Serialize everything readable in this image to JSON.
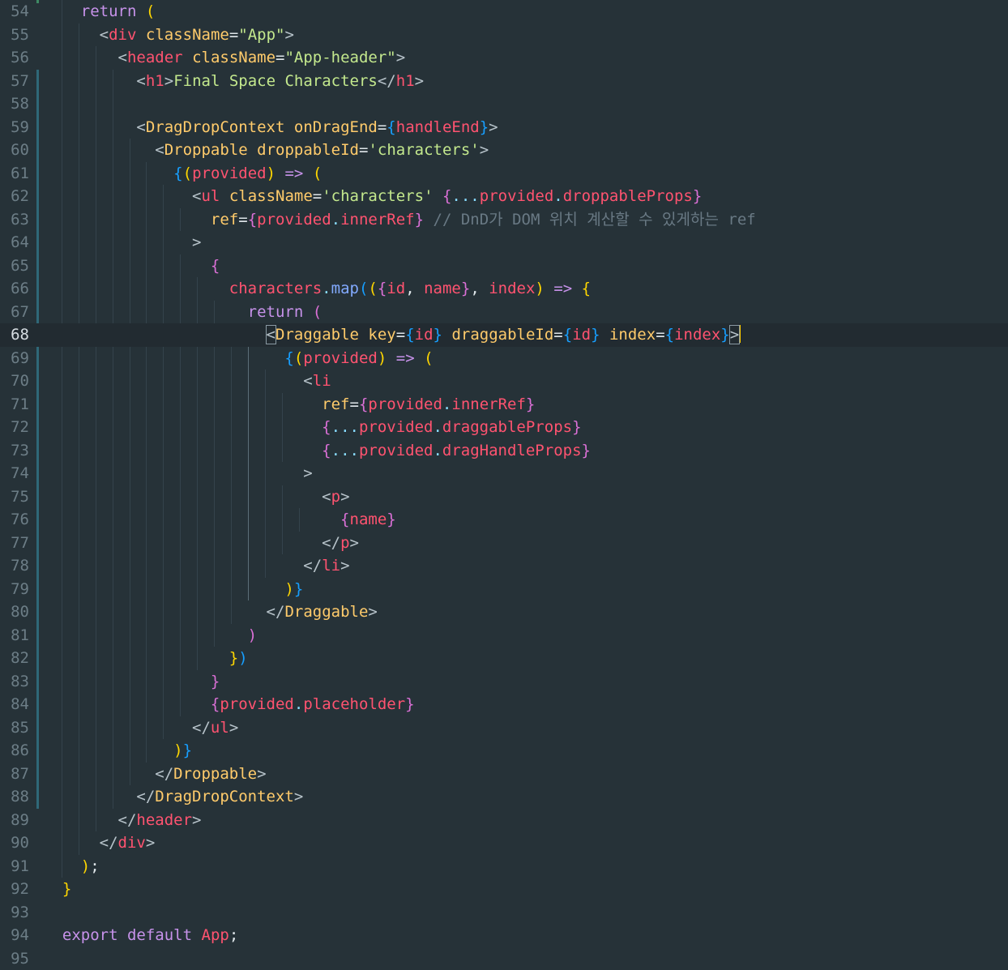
{
  "editor": {
    "active_line": 68,
    "lines": [
      {
        "n": "54",
        "t": [
          [
            "t-kw",
            "    return "
          ],
          [
            "t-br1",
            "("
          ]
        ]
      },
      {
        "n": "55",
        "t": [
          [
            "t-plain",
            "      "
          ],
          [
            "t-dim",
            "<"
          ],
          [
            "t-tag",
            "div"
          ],
          [
            "t-plain",
            " "
          ],
          [
            "t-attr",
            "className"
          ],
          [
            "t-plain",
            "="
          ],
          [
            "t-str",
            "\"App\""
          ],
          [
            "t-dim",
            ">"
          ]
        ]
      },
      {
        "n": "56",
        "t": [
          [
            "t-plain",
            "        "
          ],
          [
            "t-dim",
            "<"
          ],
          [
            "t-tag",
            "header"
          ],
          [
            "t-plain",
            " "
          ],
          [
            "t-attr",
            "className"
          ],
          [
            "t-plain",
            "="
          ],
          [
            "t-str",
            "\"App-header\""
          ],
          [
            "t-dim",
            ">"
          ]
        ]
      },
      {
        "n": "57",
        "t": [
          [
            "t-plain",
            "          "
          ],
          [
            "t-dim",
            "<"
          ],
          [
            "t-tag",
            "h1"
          ],
          [
            "t-dim",
            ">"
          ],
          [
            "t-str",
            "Final Space Characters"
          ],
          [
            "t-dim",
            "</"
          ],
          [
            "t-tag",
            "h1"
          ],
          [
            "t-dim",
            ">"
          ]
        ]
      },
      {
        "n": "58",
        "t": []
      },
      {
        "n": "59",
        "t": [
          [
            "t-plain",
            "          "
          ],
          [
            "t-dim",
            "<"
          ],
          [
            "t-attr",
            "DragDropContext"
          ],
          [
            "t-plain",
            " "
          ],
          [
            "t-attr",
            "onDragEnd"
          ],
          [
            "t-plain",
            "="
          ],
          [
            "t-br3",
            "{"
          ],
          [
            "t-var",
            "handleEnd"
          ],
          [
            "t-br3",
            "}"
          ],
          [
            "t-dim",
            ">"
          ]
        ]
      },
      {
        "n": "60",
        "t": [
          [
            "t-plain",
            "            "
          ],
          [
            "t-dim",
            "<"
          ],
          [
            "t-attr",
            "Droppable"
          ],
          [
            "t-plain",
            " "
          ],
          [
            "t-attr",
            "droppableId"
          ],
          [
            "t-plain",
            "="
          ],
          [
            "t-str",
            "'characters'"
          ],
          [
            "t-dim",
            ">"
          ]
        ]
      },
      {
        "n": "61",
        "t": [
          [
            "t-plain",
            "              "
          ],
          [
            "t-br3",
            "{"
          ],
          [
            "t-br1",
            "("
          ],
          [
            "t-var",
            "provided"
          ],
          [
            "t-br1",
            ")"
          ],
          [
            "t-plain",
            " "
          ],
          [
            "t-kw",
            "=>"
          ],
          [
            "t-plain",
            " "
          ],
          [
            "t-br1",
            "("
          ]
        ]
      },
      {
        "n": "62",
        "t": [
          [
            "t-plain",
            "                "
          ],
          [
            "t-dim",
            "<"
          ],
          [
            "t-tag",
            "ul"
          ],
          [
            "t-plain",
            " "
          ],
          [
            "t-attr",
            "className"
          ],
          [
            "t-plain",
            "="
          ],
          [
            "t-str",
            "'characters'"
          ],
          [
            "t-plain",
            " "
          ],
          [
            "t-br2",
            "{"
          ],
          [
            "t-punc",
            "..."
          ],
          [
            "t-var",
            "provided"
          ],
          [
            "t-punc",
            "."
          ],
          [
            "t-prop",
            "droppableProps"
          ],
          [
            "t-br2",
            "}"
          ]
        ]
      },
      {
        "n": "63",
        "t": [
          [
            "t-plain",
            "                  "
          ],
          [
            "t-attr",
            "ref"
          ],
          [
            "t-plain",
            "="
          ],
          [
            "t-br2",
            "{"
          ],
          [
            "t-var",
            "provided"
          ],
          [
            "t-punc",
            "."
          ],
          [
            "t-prop",
            "innerRef"
          ],
          [
            "t-br2",
            "}"
          ],
          [
            "t-plain",
            " "
          ],
          [
            "t-cmt",
            "// DnD가 DOM 위치 계산할 수 있게하는 ref"
          ]
        ]
      },
      {
        "n": "64",
        "t": [
          [
            "t-plain",
            "                "
          ],
          [
            "t-dim",
            ">"
          ]
        ]
      },
      {
        "n": "65",
        "t": [
          [
            "t-plain",
            "                  "
          ],
          [
            "t-br2",
            "{"
          ]
        ]
      },
      {
        "n": "66",
        "t": [
          [
            "t-plain",
            "                    "
          ],
          [
            "t-var",
            "characters"
          ],
          [
            "t-punc",
            "."
          ],
          [
            "t-fn",
            "map"
          ],
          [
            "t-br3",
            "("
          ],
          [
            "t-br1",
            "("
          ],
          [
            "t-br2",
            "{"
          ],
          [
            "t-var",
            "id"
          ],
          [
            "t-plain",
            ", "
          ],
          [
            "t-var",
            "name"
          ],
          [
            "t-br2",
            "}"
          ],
          [
            "t-plain",
            ", "
          ],
          [
            "t-var",
            "index"
          ],
          [
            "t-br1",
            ")"
          ],
          [
            "t-plain",
            " "
          ],
          [
            "t-kw",
            "=>"
          ],
          [
            "t-plain",
            " "
          ],
          [
            "t-br1",
            "{"
          ]
        ]
      },
      {
        "n": "67",
        "t": [
          [
            "t-plain",
            "                      "
          ],
          [
            "t-kw",
            "return"
          ],
          [
            "t-plain",
            " "
          ],
          [
            "t-br2",
            "("
          ]
        ]
      },
      {
        "n": "68",
        "t": [
          [
            "t-plain",
            "                        "
          ],
          [
            "t-dim hl",
            "<"
          ],
          [
            "t-attr",
            "Draggable"
          ],
          [
            "t-plain",
            " "
          ],
          [
            "t-attr",
            "key"
          ],
          [
            "t-plain",
            "="
          ],
          [
            "t-br3",
            "{"
          ],
          [
            "t-var",
            "id"
          ],
          [
            "t-br3",
            "}"
          ],
          [
            "t-plain",
            " "
          ],
          [
            "t-attr",
            "draggableId"
          ],
          [
            "t-plain",
            "="
          ],
          [
            "t-br3",
            "{"
          ],
          [
            "t-var",
            "id"
          ],
          [
            "t-br3",
            "}"
          ],
          [
            "t-plain",
            " "
          ],
          [
            "t-attr",
            "index"
          ],
          [
            "t-plain",
            "="
          ],
          [
            "t-br3",
            "{"
          ],
          [
            "t-var",
            "index"
          ],
          [
            "t-br3",
            "}"
          ],
          [
            "t-dim hl",
            ">"
          ],
          [
            "cursor",
            ""
          ]
        ]
      },
      {
        "n": "69",
        "t": [
          [
            "t-plain",
            "                          "
          ],
          [
            "t-br3",
            "{"
          ],
          [
            "t-br1",
            "("
          ],
          [
            "t-var",
            "provided"
          ],
          [
            "t-br1",
            ")"
          ],
          [
            "t-plain",
            " "
          ],
          [
            "t-kw",
            "=>"
          ],
          [
            "t-plain",
            " "
          ],
          [
            "t-br1",
            "("
          ]
        ]
      },
      {
        "n": "70",
        "t": [
          [
            "t-plain",
            "                            "
          ],
          [
            "t-dim",
            "<"
          ],
          [
            "t-tag",
            "li"
          ]
        ]
      },
      {
        "n": "71",
        "t": [
          [
            "t-plain",
            "                              "
          ],
          [
            "t-attr",
            "ref"
          ],
          [
            "t-plain",
            "="
          ],
          [
            "t-br2",
            "{"
          ],
          [
            "t-var",
            "provided"
          ],
          [
            "t-punc",
            "."
          ],
          [
            "t-prop",
            "innerRef"
          ],
          [
            "t-br2",
            "}"
          ]
        ]
      },
      {
        "n": "72",
        "t": [
          [
            "t-plain",
            "                              "
          ],
          [
            "t-br2",
            "{"
          ],
          [
            "t-punc",
            "..."
          ],
          [
            "t-var",
            "provided"
          ],
          [
            "t-punc",
            "."
          ],
          [
            "t-prop",
            "draggableProps"
          ],
          [
            "t-br2",
            "}"
          ]
        ]
      },
      {
        "n": "73",
        "t": [
          [
            "t-plain",
            "                              "
          ],
          [
            "t-br2",
            "{"
          ],
          [
            "t-punc",
            "..."
          ],
          [
            "t-var",
            "provided"
          ],
          [
            "t-punc",
            "."
          ],
          [
            "t-prop",
            "dragHandleProps"
          ],
          [
            "t-br2",
            "}"
          ]
        ]
      },
      {
        "n": "74",
        "t": [
          [
            "t-plain",
            "                            "
          ],
          [
            "t-dim",
            ">"
          ]
        ]
      },
      {
        "n": "75",
        "t": [
          [
            "t-plain",
            "                              "
          ],
          [
            "t-dim",
            "<"
          ],
          [
            "t-tag",
            "p"
          ],
          [
            "t-dim",
            ">"
          ]
        ]
      },
      {
        "n": "76",
        "t": [
          [
            "t-plain",
            "                                "
          ],
          [
            "t-br2",
            "{"
          ],
          [
            "t-var",
            "name"
          ],
          [
            "t-br2",
            "}"
          ]
        ]
      },
      {
        "n": "77",
        "t": [
          [
            "t-plain",
            "                              "
          ],
          [
            "t-dim",
            "</"
          ],
          [
            "t-tag",
            "p"
          ],
          [
            "t-dim",
            ">"
          ]
        ]
      },
      {
        "n": "78",
        "t": [
          [
            "t-plain",
            "                            "
          ],
          [
            "t-dim",
            "</"
          ],
          [
            "t-tag",
            "li"
          ],
          [
            "t-dim",
            ">"
          ]
        ]
      },
      {
        "n": "79",
        "t": [
          [
            "t-plain",
            "                          "
          ],
          [
            "t-br1",
            ")"
          ],
          [
            "t-br3",
            "}"
          ]
        ]
      },
      {
        "n": "80",
        "t": [
          [
            "t-plain",
            "                        "
          ],
          [
            "t-dim",
            "</"
          ],
          [
            "t-attr",
            "Draggable"
          ],
          [
            "t-dim",
            ">"
          ]
        ]
      },
      {
        "n": "81",
        "t": [
          [
            "t-plain",
            "                      "
          ],
          [
            "t-br2",
            ")"
          ]
        ]
      },
      {
        "n": "82",
        "t": [
          [
            "t-plain",
            "                    "
          ],
          [
            "t-br1",
            "}"
          ],
          [
            "t-br3",
            ")"
          ]
        ]
      },
      {
        "n": "83",
        "t": [
          [
            "t-plain",
            "                  "
          ],
          [
            "t-br2",
            "}"
          ]
        ]
      },
      {
        "n": "84",
        "t": [
          [
            "t-plain",
            "                  "
          ],
          [
            "t-br2",
            "{"
          ],
          [
            "t-var",
            "provided"
          ],
          [
            "t-punc",
            "."
          ],
          [
            "t-prop",
            "placeholder"
          ],
          [
            "t-br2",
            "}"
          ]
        ]
      },
      {
        "n": "85",
        "t": [
          [
            "t-plain",
            "                "
          ],
          [
            "t-dim",
            "</"
          ],
          [
            "t-tag",
            "ul"
          ],
          [
            "t-dim",
            ">"
          ]
        ]
      },
      {
        "n": "86",
        "t": [
          [
            "t-plain",
            "              "
          ],
          [
            "t-br1",
            ")"
          ],
          [
            "t-br3",
            "}"
          ]
        ]
      },
      {
        "n": "87",
        "t": [
          [
            "t-plain",
            "            "
          ],
          [
            "t-dim",
            "</"
          ],
          [
            "t-attr",
            "Droppable"
          ],
          [
            "t-dim",
            ">"
          ]
        ]
      },
      {
        "n": "88",
        "t": [
          [
            "t-plain",
            "          "
          ],
          [
            "t-dim",
            "</"
          ],
          [
            "t-attr",
            "DragDropContext"
          ],
          [
            "t-dim",
            ">"
          ]
        ]
      },
      {
        "n": "89",
        "t": [
          [
            "t-plain",
            "        "
          ],
          [
            "t-dim",
            "</"
          ],
          [
            "t-tag",
            "header"
          ],
          [
            "t-dim",
            ">"
          ]
        ]
      },
      {
        "n": "90",
        "t": [
          [
            "t-plain",
            "      "
          ],
          [
            "t-dim",
            "</"
          ],
          [
            "t-tag",
            "div"
          ],
          [
            "t-dim",
            ">"
          ]
        ]
      },
      {
        "n": "91",
        "t": [
          [
            "t-plain",
            "    "
          ],
          [
            "t-br1",
            ")"
          ],
          [
            "t-plain",
            ";"
          ]
        ]
      },
      {
        "n": "92",
        "t": [
          [
            "t-plain",
            "  "
          ],
          [
            "t-br1",
            "}"
          ]
        ]
      },
      {
        "n": "93",
        "t": []
      },
      {
        "n": "94",
        "t": [
          [
            "t-plain",
            "  "
          ],
          [
            "t-kw",
            "export"
          ],
          [
            "t-plain",
            " "
          ],
          [
            "t-kw",
            "default"
          ],
          [
            "t-plain",
            " "
          ],
          [
            "t-var",
            "App"
          ],
          [
            "t-plain",
            ";"
          ]
        ]
      },
      {
        "n": "95",
        "t": []
      }
    ]
  },
  "colors": {
    "background": "#263238",
    "active_line": "#222b31",
    "cursor": "#ffcc00",
    "keyword": "#c792ea",
    "tag": "#ff5370",
    "attribute": "#ffcb6b",
    "string": "#c3e88d",
    "comment": "#697984"
  }
}
